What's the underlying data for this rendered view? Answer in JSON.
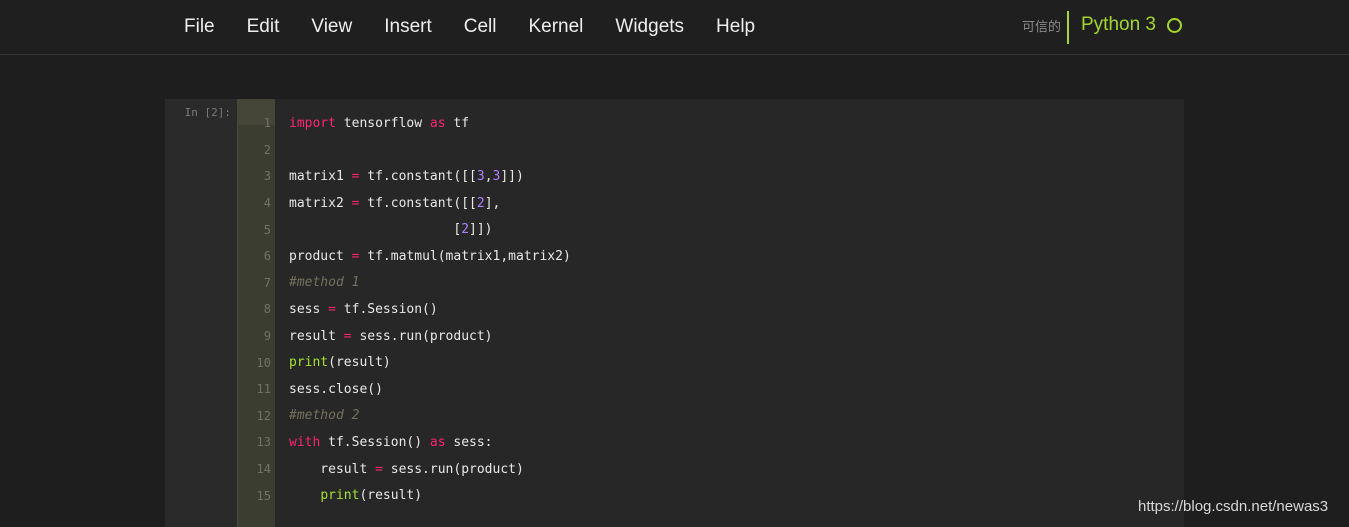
{
  "menu": {
    "items": [
      "File",
      "Edit",
      "View",
      "Insert",
      "Cell",
      "Kernel",
      "Widgets",
      "Help"
    ]
  },
  "status": {
    "trusted": "可信的",
    "kernel_name": "Python 3",
    "kernel_indicator_icon": "kernel-idle-circle-icon"
  },
  "colors": {
    "accent_green": "#a6d62b",
    "keyword_pink": "#f92672",
    "builtin_green": "#a6e22e",
    "number_purple": "#ae81ff",
    "comment_gray": "#75715e"
  },
  "cell": {
    "prompt": "In [2]:",
    "lines": [
      {
        "n": "1",
        "tokens": [
          {
            "t": "import",
            "c": "kw"
          },
          {
            "t": " tensorflow ",
            "c": "tx"
          },
          {
            "t": "as",
            "c": "kw"
          },
          {
            "t": " tf",
            "c": "tx"
          }
        ]
      },
      {
        "n": "2",
        "tokens": []
      },
      {
        "n": "3",
        "tokens": [
          {
            "t": "matrix1 ",
            "c": "tx"
          },
          {
            "t": "=",
            "c": "op"
          },
          {
            "t": " tf.constant([[",
            "c": "tx"
          },
          {
            "t": "3",
            "c": "num"
          },
          {
            "t": ",",
            "c": "tx"
          },
          {
            "t": "3",
            "c": "num"
          },
          {
            "t": "]])",
            "c": "tx"
          }
        ]
      },
      {
        "n": "4",
        "tokens": [
          {
            "t": "matrix2 ",
            "c": "tx"
          },
          {
            "t": "=",
            "c": "op"
          },
          {
            "t": " tf.constant([[",
            "c": "tx"
          },
          {
            "t": "2",
            "c": "num"
          },
          {
            "t": "],",
            "c": "tx"
          }
        ]
      },
      {
        "n": "5",
        "tokens": [
          {
            "t": "                     [",
            "c": "tx"
          },
          {
            "t": "2",
            "c": "num"
          },
          {
            "t": "]])",
            "c": "tx"
          }
        ]
      },
      {
        "n": "6",
        "tokens": [
          {
            "t": "product ",
            "c": "tx"
          },
          {
            "t": "=",
            "c": "op"
          },
          {
            "t": " tf.matmul(matrix1,matrix2)",
            "c": "tx"
          }
        ]
      },
      {
        "n": "7",
        "tokens": [
          {
            "t": "#method 1",
            "c": "cm"
          }
        ]
      },
      {
        "n": "8",
        "tokens": [
          {
            "t": "sess ",
            "c": "tx"
          },
          {
            "t": "=",
            "c": "op"
          },
          {
            "t": " tf.Session()",
            "c": "tx"
          }
        ]
      },
      {
        "n": "9",
        "tokens": [
          {
            "t": "result ",
            "c": "tx"
          },
          {
            "t": "=",
            "c": "op"
          },
          {
            "t": " sess.run(product)",
            "c": "tx"
          }
        ]
      },
      {
        "n": "10",
        "tokens": [
          {
            "t": "print",
            "c": "bi"
          },
          {
            "t": "(result)",
            "c": "tx"
          }
        ]
      },
      {
        "n": "11",
        "tokens": [
          {
            "t": "sess.close()",
            "c": "tx"
          }
        ]
      },
      {
        "n": "12",
        "tokens": [
          {
            "t": "#method 2",
            "c": "cm"
          }
        ]
      },
      {
        "n": "13",
        "tokens": [
          {
            "t": "with",
            "c": "kw"
          },
          {
            "t": " tf.Session() ",
            "c": "tx"
          },
          {
            "t": "as",
            "c": "kw"
          },
          {
            "t": " sess:",
            "c": "tx"
          }
        ]
      },
      {
        "n": "14",
        "tokens": [
          {
            "t": "    result ",
            "c": "tx"
          },
          {
            "t": "=",
            "c": "op"
          },
          {
            "t": " sess.run(product)",
            "c": "tx"
          }
        ]
      },
      {
        "n": "15",
        "tokens": [
          {
            "t": "    ",
            "c": "tx"
          },
          {
            "t": "print",
            "c": "bi"
          },
          {
            "t": "(result)",
            "c": "tx"
          }
        ]
      }
    ]
  },
  "watermark": "https://blog.csdn.net/newas3"
}
